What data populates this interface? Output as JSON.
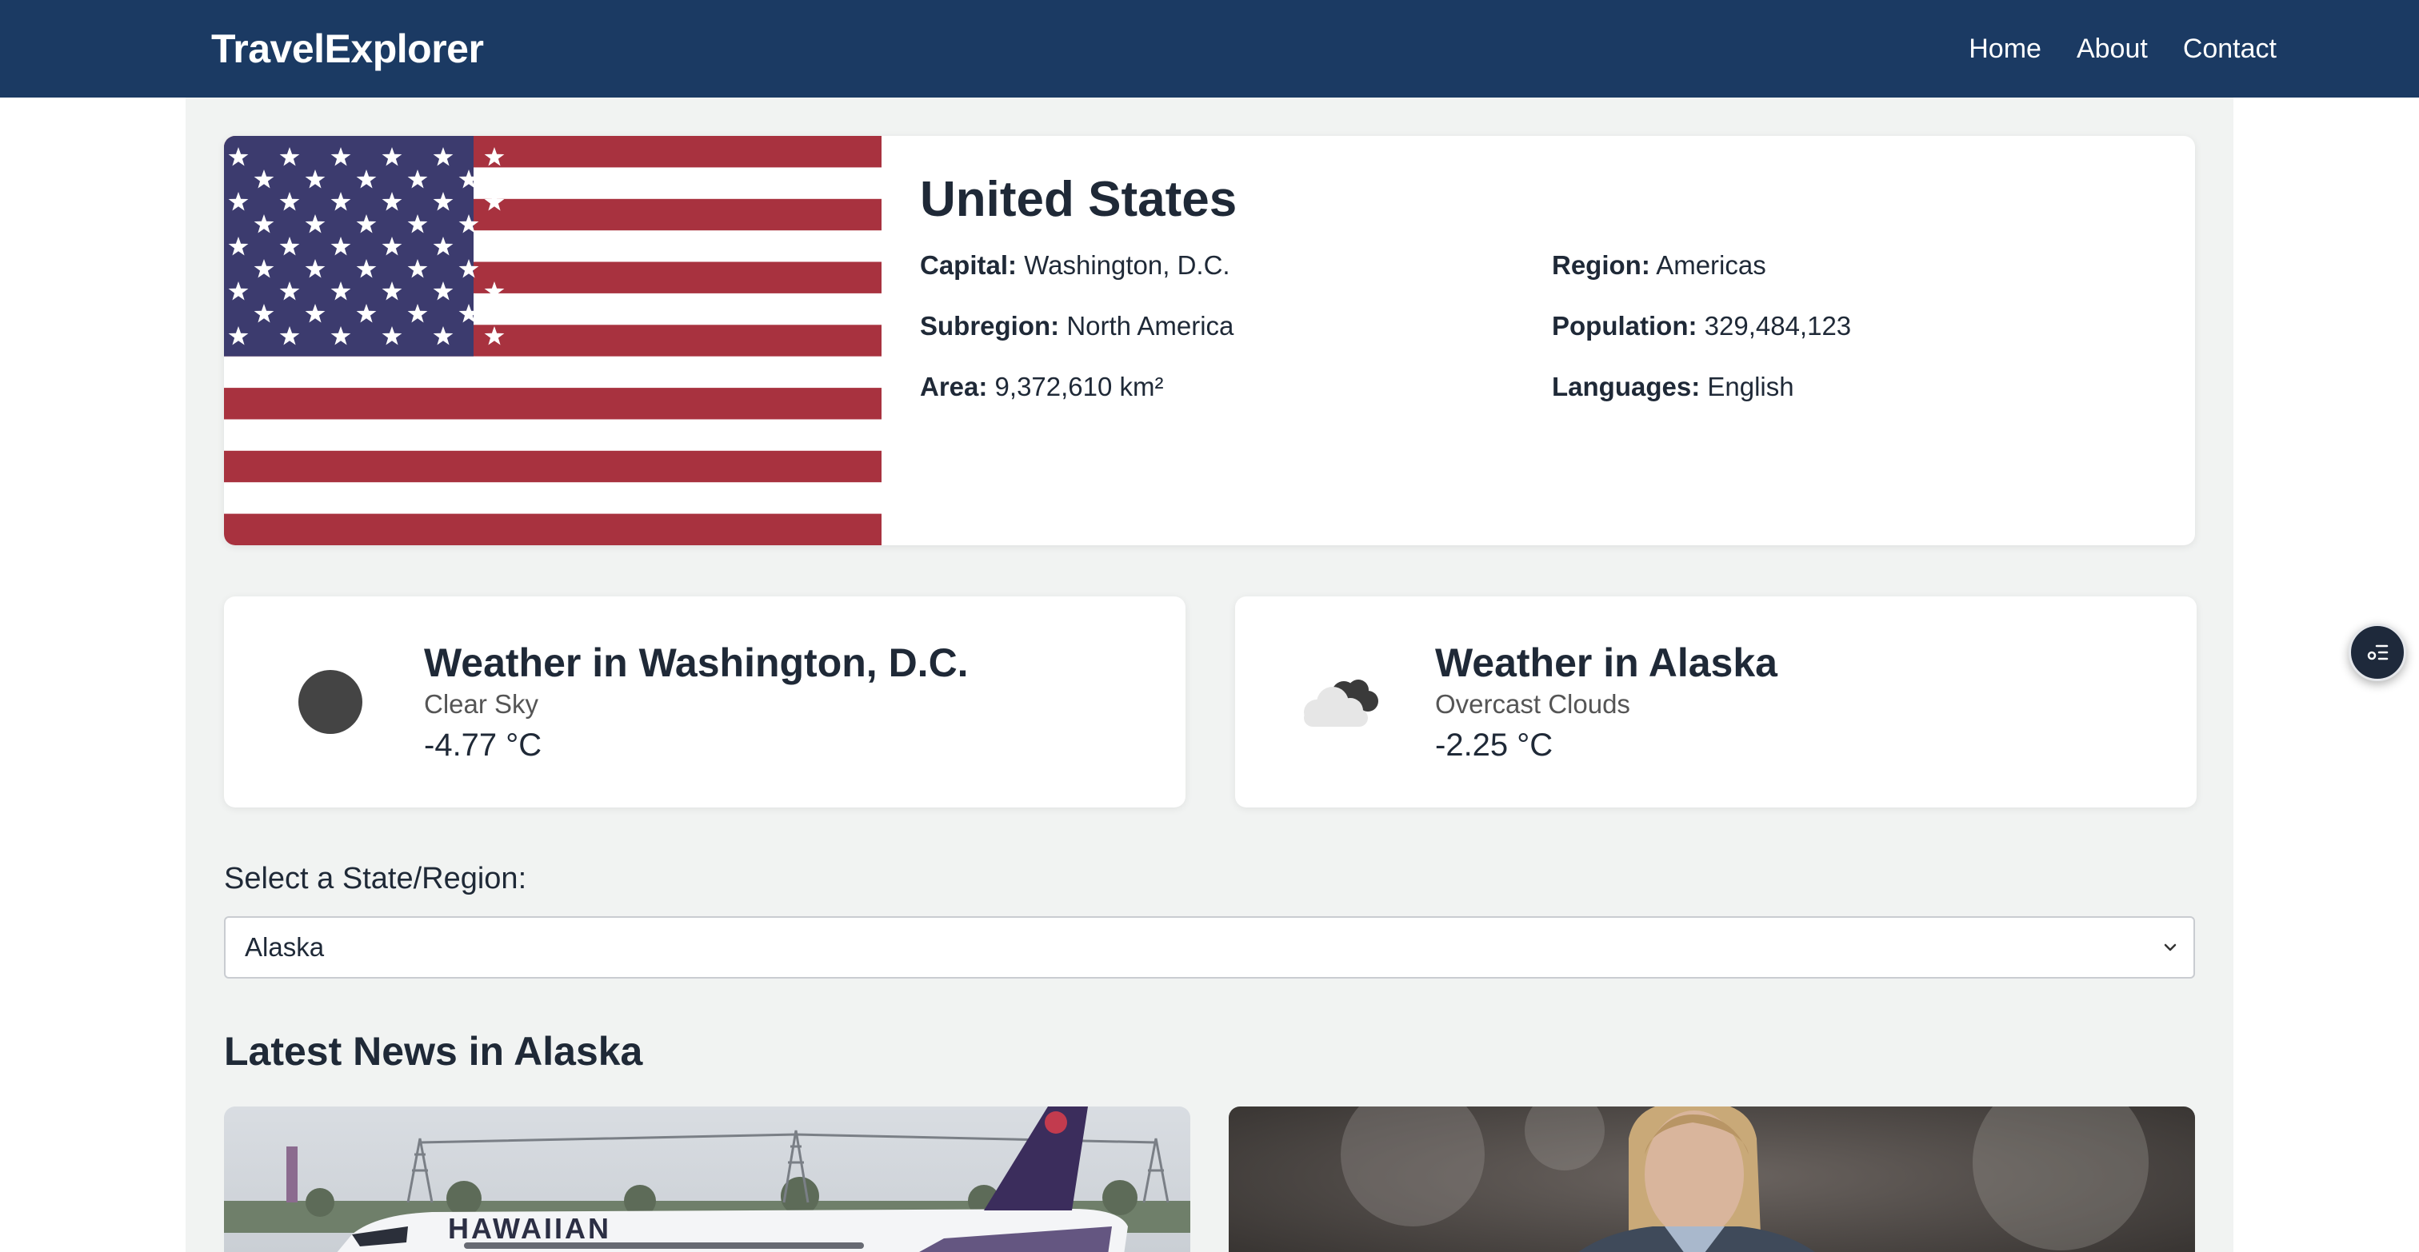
{
  "header": {
    "brand": "TravelExplorer",
    "nav": [
      "Home",
      "About",
      "Contact"
    ]
  },
  "country": {
    "name": "United States",
    "fields": [
      {
        "label": "Capital:",
        "value": "Washington, D.C."
      },
      {
        "label": "Region:",
        "value": "Americas"
      },
      {
        "label": "Subregion:",
        "value": "North America"
      },
      {
        "label": "Population:",
        "value": "329,484,123"
      },
      {
        "label": "Area:",
        "value": "9,372,610 km²"
      },
      {
        "label": "Languages:",
        "value": "English"
      }
    ]
  },
  "weather": [
    {
      "title": "Weather in Washington, D.C.",
      "desc": "Clear Sky",
      "temp": "-4.77 °C",
      "icon": "clear-night-icon"
    },
    {
      "title": "Weather in Alaska",
      "desc": "Overcast Clouds",
      "temp": "-2.25 °C",
      "icon": "overcast-clouds-icon"
    }
  ],
  "region_select": {
    "label": "Select a State/Region:",
    "value": "Alaska"
  },
  "news": {
    "title": "Latest News in Alaska",
    "items": [
      {
        "image": "hawaiian-airlines-plane-image",
        "overlay_text": "HAWAIIAN"
      },
      {
        "image": "senator-portrait-image"
      }
    ]
  },
  "colors": {
    "header_bg": "#1b3a63",
    "page_bg": "#f1f3f2",
    "flag_red": "#a8323f",
    "flag_blue": "#3c3b6e"
  }
}
